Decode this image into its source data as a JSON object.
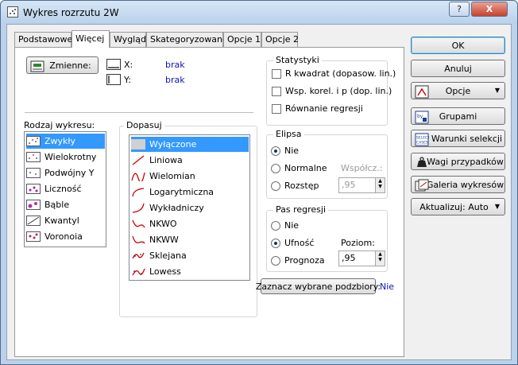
{
  "window": {
    "title": "Wykres rozrzutu 2W",
    "help_label": "?",
    "close_label": "X"
  },
  "tabs": [
    {
      "label": "Podstawowe"
    },
    {
      "label": "Więcej"
    },
    {
      "label": "Wygląd"
    },
    {
      "label": "Skategoryzowane"
    },
    {
      "label": "Opcje 1"
    },
    {
      "label": "Opcje 2"
    }
  ],
  "variables": {
    "button_label": "Zmienne:",
    "x_label": "X:",
    "x_value": "brak",
    "y_label": "Y:",
    "y_value": "brak"
  },
  "statystyki": {
    "legend": "Statystyki",
    "items": [
      {
        "label": "R kwadrat (dopasow. lin.)",
        "checked": false
      },
      {
        "label": "Wsp. korel. i p (dop. lin.)",
        "checked": false
      },
      {
        "label": "Równanie regresji",
        "checked": false
      }
    ]
  },
  "rodzaj": {
    "label": "Rodzaj wykresu:",
    "items": [
      {
        "label": "Zwykły",
        "selected": true
      },
      {
        "label": "Wielokrotny"
      },
      {
        "label": "Podwójny Y"
      },
      {
        "label": "Liczność"
      },
      {
        "label": "Bąble"
      },
      {
        "label": "Kwantyl"
      },
      {
        "label": "Voronoia"
      }
    ]
  },
  "dopasuj": {
    "legend": "Dopasuj",
    "items": [
      {
        "label": "Wyłączone",
        "selected": true
      },
      {
        "label": "Liniowa"
      },
      {
        "label": "Wielomian"
      },
      {
        "label": "Logarytmiczna"
      },
      {
        "label": "Wykładniczy"
      },
      {
        "label": "NKWO"
      },
      {
        "label": "NKWW"
      },
      {
        "label": "Sklejana"
      },
      {
        "label": "Lowess"
      }
    ]
  },
  "elipsa": {
    "legend": "Elipsa",
    "options": [
      {
        "label": "Nie",
        "selected": true
      },
      {
        "label": "Normalne"
      },
      {
        "label": "Rozstęp"
      }
    ],
    "coef_label": "Współcz.:",
    "coef_value": ",95"
  },
  "pas": {
    "legend": "Pas regresji",
    "options": [
      {
        "label": "Nie"
      },
      {
        "label": "Ufność",
        "selected": true
      },
      {
        "label": "Prognoza"
      }
    ],
    "level_label": "Poziom:",
    "level_value": ",95"
  },
  "subsets": {
    "button_label": "Zaznacz wybrane podzbiory:",
    "value": "Nie"
  },
  "side_buttons": {
    "ok": "OK",
    "cancel": "Anuluj",
    "options": "Opcje",
    "groups": "Grupami",
    "selection": "Warunki selekcji",
    "weights": "Wagi przypadków",
    "gallery": "Galeria wykresów",
    "update": "Aktualizuj: Auto"
  },
  "colors": {
    "selection": "#3399ff",
    "value_text": "#1010c0",
    "accent": "#3c7fb1"
  }
}
